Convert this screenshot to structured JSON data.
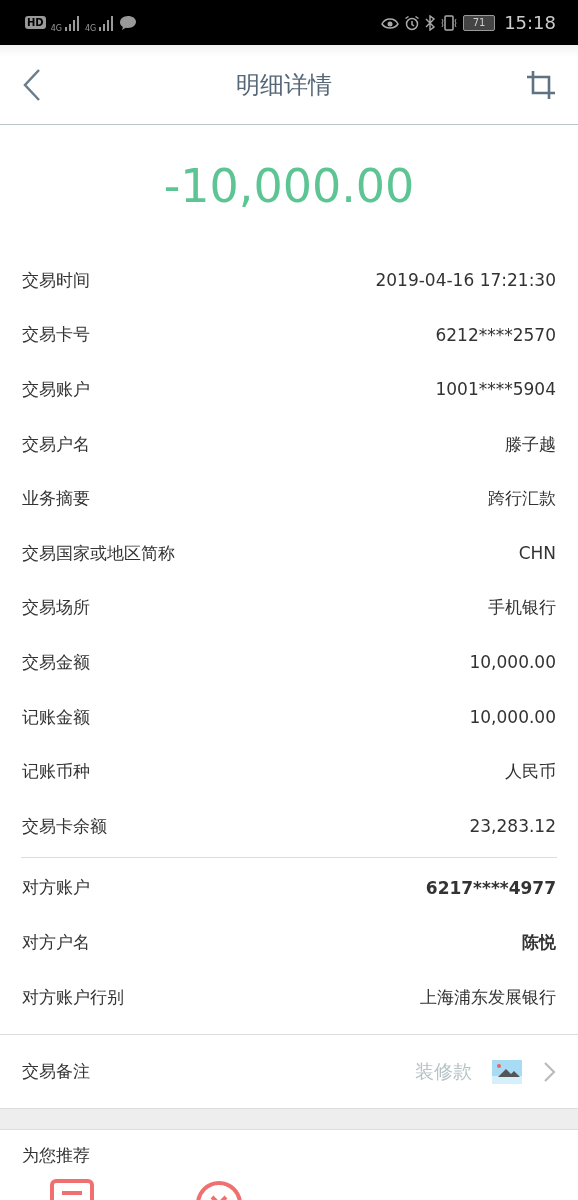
{
  "status_bar": {
    "left_badges": [
      "HD",
      "4G",
      "4G"
    ],
    "battery": "71",
    "time": "15:18"
  },
  "header": {
    "title": "明细详情"
  },
  "amount": "-10,000.00",
  "details": [
    {
      "label": "交易时间",
      "value": "2019-04-16 17:21:30"
    },
    {
      "label": "交易卡号",
      "value": "6212****2570"
    },
    {
      "label": "交易账户",
      "value": "1001****5904"
    },
    {
      "label": "交易户名",
      "value": "滕子越"
    },
    {
      "label": "业务摘要",
      "value": "跨行汇款"
    },
    {
      "label": "交易国家或地区简称",
      "value": "CHN"
    },
    {
      "label": "交易场所",
      "value": "手机银行"
    },
    {
      "label": "交易金额",
      "value": "10,000.00"
    },
    {
      "label": "记账金额",
      "value": "10,000.00"
    },
    {
      "label": "记账币种",
      "value": "人民币"
    },
    {
      "label": "交易卡余额",
      "value": "23,283.12"
    }
  ],
  "counterparty": [
    {
      "label": "对方账户",
      "value": "6217****4977",
      "bold": true
    },
    {
      "label": "对方户名",
      "value": "陈悦",
      "bold": true
    },
    {
      "label": "对方账户行别",
      "value": "上海浦东发展银行",
      "bold": false
    }
  ],
  "remark": {
    "label": "交易备注",
    "value": "装修款"
  },
  "recommend": {
    "title": "为您推荐"
  }
}
